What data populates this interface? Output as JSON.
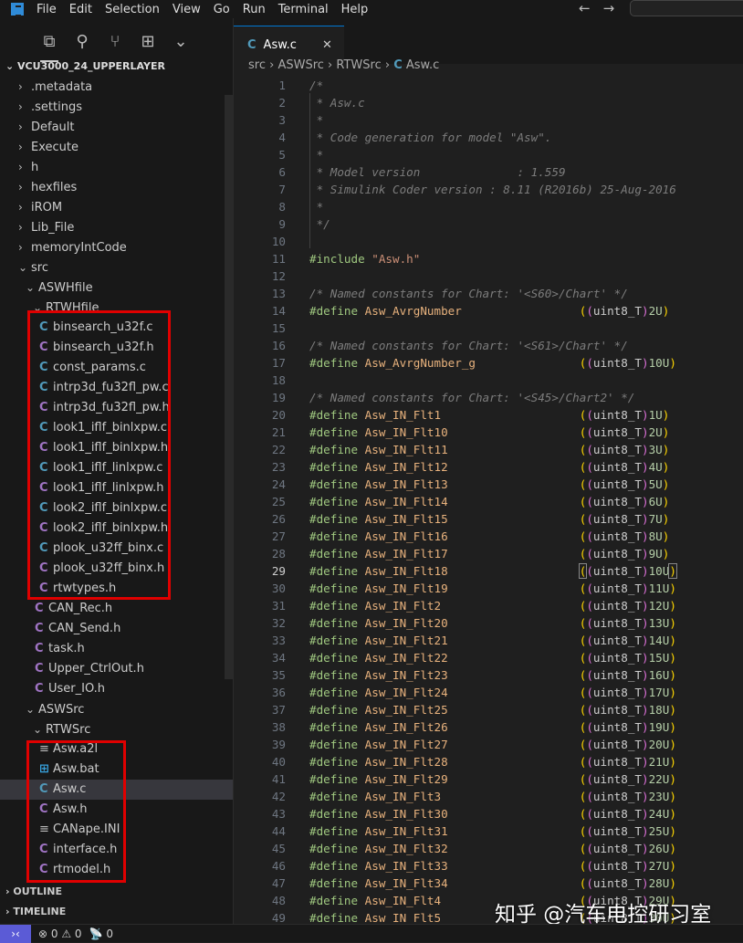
{
  "titlebar": {
    "menus": [
      "File",
      "Edit",
      "Selection",
      "View",
      "Go",
      "Run",
      "Terminal",
      "Help"
    ]
  },
  "explorer": {
    "title": "VCU3000_24_UPPERLAYER",
    "outline": "OUTLINE",
    "timeline": "TIMELINE",
    "items": [
      {
        "label": ".metadata",
        "depth": 0,
        "type": "folder"
      },
      {
        "label": ".settings",
        "depth": 0,
        "type": "folder"
      },
      {
        "label": "Default",
        "depth": 0,
        "type": "folder"
      },
      {
        "label": "Execute",
        "depth": 0,
        "type": "folder"
      },
      {
        "label": "h",
        "depth": 0,
        "type": "folder"
      },
      {
        "label": "hexfiles",
        "depth": 0,
        "type": "folder"
      },
      {
        "label": "iROM",
        "depth": 0,
        "type": "folder"
      },
      {
        "label": "Lib_File",
        "depth": 0,
        "type": "folder"
      },
      {
        "label": "memoryIntCode",
        "depth": 0,
        "type": "folder"
      },
      {
        "label": "src",
        "depth": 0,
        "type": "open"
      },
      {
        "label": "ASWHfile",
        "depth": 1,
        "type": "open"
      },
      {
        "label": "RTWHfile",
        "depth": 2,
        "type": "open"
      },
      {
        "label": "binsearch_u32f.c",
        "depth": 3,
        "type": "c"
      },
      {
        "label": "binsearch_u32f.h",
        "depth": 3,
        "type": "h"
      },
      {
        "label": "const_params.c",
        "depth": 3,
        "type": "c"
      },
      {
        "label": "intrp3d_fu32fl_pw.c",
        "depth": 3,
        "type": "c"
      },
      {
        "label": "intrp3d_fu32fl_pw.h",
        "depth": 3,
        "type": "h"
      },
      {
        "label": "look1_iflf_binlxpw.c",
        "depth": 3,
        "type": "c"
      },
      {
        "label": "look1_iflf_binlxpw.h",
        "depth": 3,
        "type": "h"
      },
      {
        "label": "look1_iflf_linlxpw.c",
        "depth": 3,
        "type": "c"
      },
      {
        "label": "look1_iflf_linlxpw.h",
        "depth": 3,
        "type": "h"
      },
      {
        "label": "look2_iflf_binlxpw.c",
        "depth": 3,
        "type": "c"
      },
      {
        "label": "look2_iflf_binlxpw.h",
        "depth": 3,
        "type": "h"
      },
      {
        "label": "plook_u32ff_binx.c",
        "depth": 3,
        "type": "c"
      },
      {
        "label": "plook_u32ff_binx.h",
        "depth": 3,
        "type": "h"
      },
      {
        "label": "rtwtypes.h",
        "depth": 3,
        "type": "h"
      },
      {
        "label": "CAN_Rec.h",
        "depth": 2,
        "type": "h"
      },
      {
        "label": "CAN_Send.h",
        "depth": 2,
        "type": "h"
      },
      {
        "label": "task.h",
        "depth": 2,
        "type": "h"
      },
      {
        "label": "Upper_CtrlOut.h",
        "depth": 2,
        "type": "h"
      },
      {
        "label": "User_IO.h",
        "depth": 2,
        "type": "h"
      },
      {
        "label": "ASWSrc",
        "depth": 1,
        "type": "open"
      },
      {
        "label": "RTWSrc",
        "depth": 2,
        "type": "open"
      },
      {
        "label": "Asw.a2l",
        "depth": 3,
        "type": "txt"
      },
      {
        "label": "Asw.bat",
        "depth": 3,
        "type": "bat"
      },
      {
        "label": "Asw.c",
        "depth": 3,
        "type": "c",
        "selected": true
      },
      {
        "label": "Asw.h",
        "depth": 3,
        "type": "h"
      },
      {
        "label": "CANape.INI",
        "depth": 3,
        "type": "txt"
      },
      {
        "label": "interface.h",
        "depth": 3,
        "type": "h"
      },
      {
        "label": "rtmodel.h",
        "depth": 3,
        "type": "h"
      }
    ]
  },
  "tab": {
    "label": "Asw.c"
  },
  "breadcrumb": [
    "src",
    "ASWSrc",
    "RTWSrc",
    "Asw.c"
  ],
  "editor": {
    "current_line": 29,
    "lines": [
      "/*",
      " * Asw.c",
      " *",
      " * Code generation for model \"Asw\".",
      " *",
      " * Model version              : 1.559",
      " * Simulink Coder version : 8.11 (R2016b) 25-Aug-2016",
      " *",
      " */",
      "",
      "#include \"Asw.h\"",
      "",
      "/* Named constants for Chart: '<S60>/Chart' */",
      {
        "d": "Asw_AvrgNumber",
        "v": "2U"
      },
      "",
      "/* Named constants for Chart: '<S61>/Chart' */",
      {
        "d": "Asw_AvrgNumber_g",
        "v": "10U"
      },
      "",
      "/* Named constants for Chart: '<S45>/Chart2' */",
      {
        "d": "Asw_IN_Flt1",
        "v": "1U"
      },
      {
        "d": "Asw_IN_Flt10",
        "v": "2U"
      },
      {
        "d": "Asw_IN_Flt11",
        "v": "3U"
      },
      {
        "d": "Asw_IN_Flt12",
        "v": "4U"
      },
      {
        "d": "Asw_IN_Flt13",
        "v": "5U"
      },
      {
        "d": "Asw_IN_Flt14",
        "v": "6U"
      },
      {
        "d": "Asw_IN_Flt15",
        "v": "7U"
      },
      {
        "d": "Asw_IN_Flt16",
        "v": "8U"
      },
      {
        "d": "Asw_IN_Flt17",
        "v": "9U"
      },
      {
        "d": "Asw_IN_Flt18",
        "v": "10U"
      },
      {
        "d": "Asw_IN_Flt19",
        "v": "11U"
      },
      {
        "d": "Asw_IN_Flt2",
        "v": "12U"
      },
      {
        "d": "Asw_IN_Flt20",
        "v": "13U"
      },
      {
        "d": "Asw_IN_Flt21",
        "v": "14U"
      },
      {
        "d": "Asw_IN_Flt22",
        "v": "15U"
      },
      {
        "d": "Asw_IN_Flt23",
        "v": "16U"
      },
      {
        "d": "Asw_IN_Flt24",
        "v": "17U"
      },
      {
        "d": "Asw_IN_Flt25",
        "v": "18U"
      },
      {
        "d": "Asw_IN_Flt26",
        "v": "19U"
      },
      {
        "d": "Asw_IN_Flt27",
        "v": "20U"
      },
      {
        "d": "Asw_IN_Flt28",
        "v": "21U"
      },
      {
        "d": "Asw_IN_Flt29",
        "v": "22U"
      },
      {
        "d": "Asw_IN_Flt3",
        "v": "23U"
      },
      {
        "d": "Asw_IN_Flt30",
        "v": "24U"
      },
      {
        "d": "Asw_IN_Flt31",
        "v": "25U"
      },
      {
        "d": "Asw_IN_Flt32",
        "v": "26U"
      },
      {
        "d": "Asw_IN_Flt33",
        "v": "27U"
      },
      {
        "d": "Asw_IN_Flt34",
        "v": "28U"
      },
      {
        "d": "Asw_IN_Flt4",
        "v": "29U"
      },
      {
        "d": "Asw_IN_Flt5",
        "v": "30U"
      }
    ]
  },
  "status": {
    "errors": "0",
    "warnings": "0",
    "ports": "0"
  },
  "watermark": "知乎 @汽车电控研习室",
  "colors": {
    "accent": "#0078d4",
    "annotation": "#e00000",
    "c_icon": "#519aba",
    "h_icon": "#a074c4"
  }
}
